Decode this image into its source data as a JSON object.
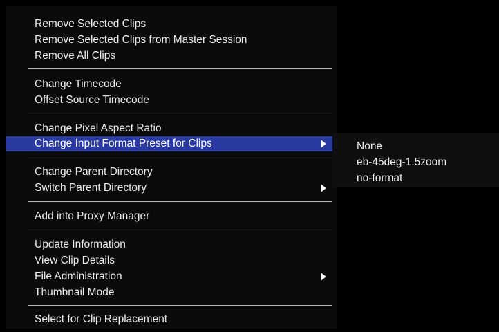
{
  "context_menu": {
    "groups": [
      {
        "items": [
          {
            "label": "Remove Selected Clips"
          },
          {
            "label": "Remove Selected Clips from Master Session"
          },
          {
            "label": "Remove All Clips"
          }
        ]
      },
      {
        "items": [
          {
            "label": "Change Timecode"
          },
          {
            "label": "Offset Source Timecode"
          }
        ]
      },
      {
        "items": [
          {
            "label": "Change Pixel Aspect Ratio"
          },
          {
            "label": "Change Input Format Preset for Clips",
            "highlighted": true,
            "has_submenu": true
          }
        ]
      },
      {
        "items": [
          {
            "label": "Change Parent Directory"
          },
          {
            "label": "Switch Parent Directory",
            "has_submenu": true
          }
        ]
      },
      {
        "items": [
          {
            "label": "Add into Proxy Manager"
          }
        ]
      },
      {
        "items": [
          {
            "label": "Update Information"
          },
          {
            "label": "View Clip Details"
          },
          {
            "label": "File Administration",
            "has_submenu": true
          },
          {
            "label": "Thumbnail Mode"
          }
        ]
      },
      {
        "items": [
          {
            "label": "Select for Clip Replacement"
          }
        ]
      }
    ]
  },
  "submenu": {
    "items": [
      {
        "label": "None"
      },
      {
        "label": "eb-45deg-1.5zoom"
      },
      {
        "label": "no-format"
      }
    ]
  },
  "colors": {
    "menu_background": "#0b0b0b",
    "highlight": "#2a3aa0",
    "text": "#ececec",
    "separator": "#b9b9b9"
  },
  "icons": {
    "submenu_arrow": "triangle-right-icon"
  }
}
